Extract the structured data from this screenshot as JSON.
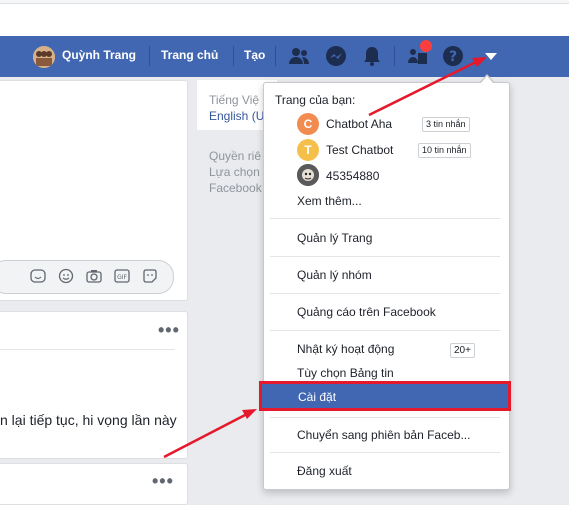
{
  "navbar": {
    "user_name": "Quỳnh Trang",
    "home_label": "Trang chủ",
    "create_label": "Tạo"
  },
  "right_column": {
    "language_current": "Tiếng Việ",
    "language_alt": "English (U",
    "footer_line1": "Quyền riê",
    "footer_line2": "Lựa chọn",
    "footer_line3": "Facebook"
  },
  "post": {
    "text": "n lại tiếp tục, hi vọng lần này"
  },
  "menu": {
    "pages_header": "Trang của bạn:",
    "pages": [
      {
        "initial": "C",
        "name": "Chatbot Aha",
        "count": "3 tin nhắn",
        "color": "#f28b50"
      },
      {
        "initial": "T",
        "name": "Test Chatbot",
        "count": "10 tin nhắn",
        "color": "#f5c04a"
      },
      {
        "initial": "",
        "name": "45354880",
        "count": "",
        "color": "#6d6d6d"
      }
    ],
    "see_more": "Xem thêm...",
    "manage_pages": "Quản lý Trang",
    "manage_groups": "Quản lý nhóm",
    "ads": "Quảng cáo trên Facebook",
    "activity_log": "Nhật ký hoạt động",
    "activity_count": "20+",
    "news_feed_prefs": "Tùy chọn Bảng tin",
    "settings": "Cài đặt",
    "switch_version": "Chuyển sang phiên bản Faceb...",
    "logout": "Đăng xuất"
  },
  "colors": {
    "brand": "#4267b2",
    "highlight_border": "#e5192b",
    "arrow": "#e5192b",
    "notification_badge": "#fa3e3e"
  }
}
